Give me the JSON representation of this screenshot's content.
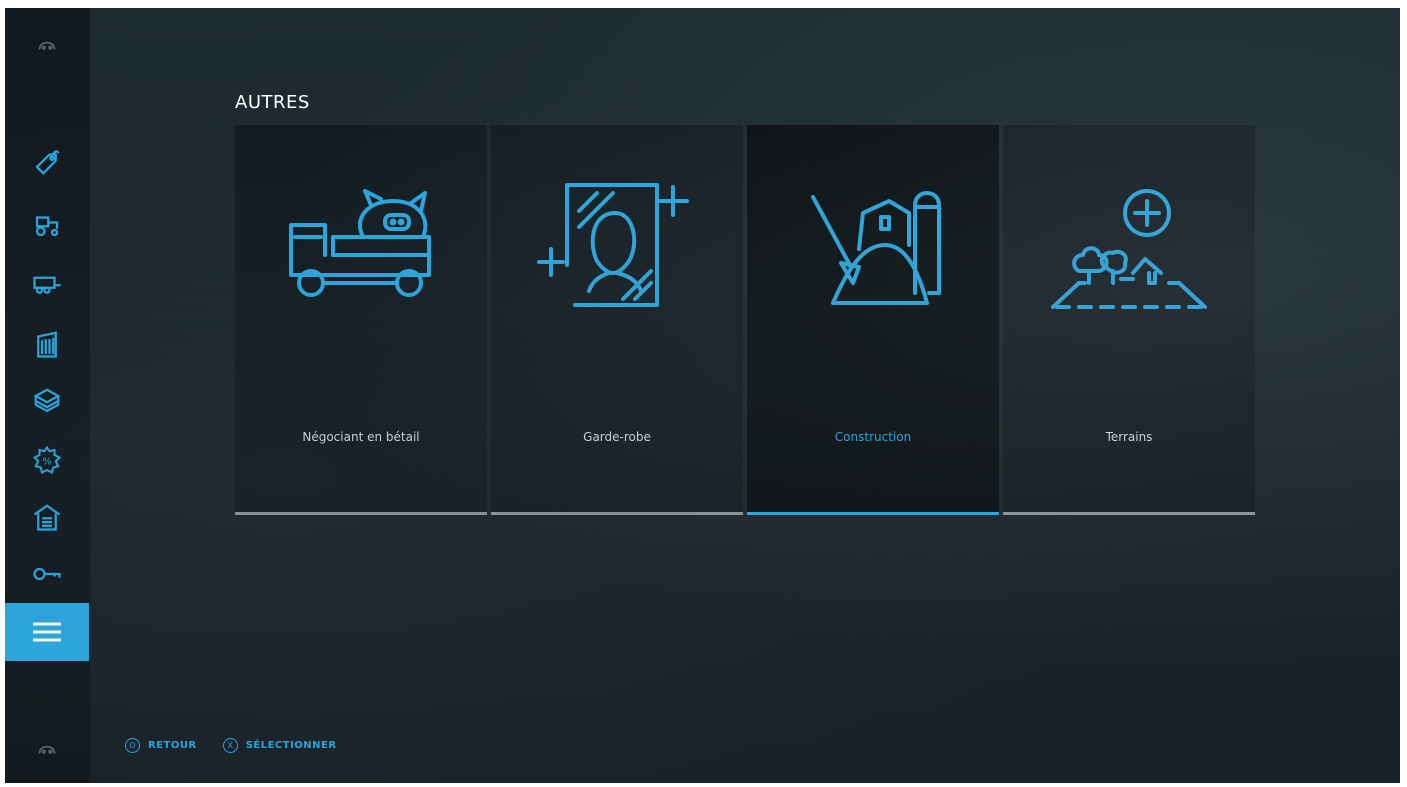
{
  "colors": {
    "accent": "#29a9e1",
    "tile_bg": "#121a1f",
    "tile_active_bg": "#060b0e",
    "bar_inactive": "#8d979c"
  },
  "sidebar": {
    "items": [
      {
        "icon": "controller-icon-top",
        "interactable": true
      },
      {
        "icon": "price-tag-icon"
      },
      {
        "icon": "tractor-icon"
      },
      {
        "icon": "trailer-icon"
      },
      {
        "icon": "silo-icon"
      },
      {
        "icon": "box-icon"
      },
      {
        "icon": "sale-badge-icon"
      },
      {
        "icon": "shed-icon"
      },
      {
        "icon": "key-icon"
      },
      {
        "icon": "menu-icon",
        "active": true
      },
      {
        "icon": "controller-icon-bottom"
      }
    ]
  },
  "main": {
    "section_title": "AUTRES",
    "tiles": [
      {
        "label": "Négociant en bétail",
        "icon": "livestock-truck-icon",
        "active": false
      },
      {
        "label": "Garde-robe",
        "icon": "wardrobe-portrait-icon",
        "active": false
      },
      {
        "label": "Construction",
        "icon": "construction-farm-icon",
        "active": true
      },
      {
        "label": "Terrains",
        "icon": "land-plus-icon",
        "active": false
      }
    ]
  },
  "footer": {
    "back_label": "RETOUR",
    "select_label": "SÉLECTIONNER",
    "back_glyph": "O",
    "select_glyph": "X"
  }
}
